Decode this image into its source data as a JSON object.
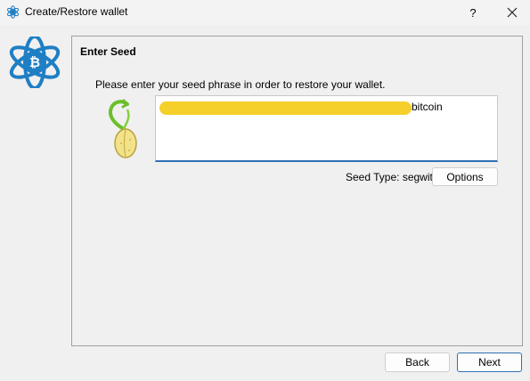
{
  "window": {
    "title": "Create/Restore wallet",
    "help_label": "?"
  },
  "panel": {
    "title": "Enter Seed",
    "instructions": "Please enter your seed phrase in order to restore your wallet.",
    "seed_visible_word": "bitcoin",
    "seed_type": "Seed Type: segwit",
    "options_label": "Options"
  },
  "footer": {
    "back_label": "Back",
    "next_label": "Next"
  },
  "colors": {
    "accent": "#2f6fb5",
    "redaction": "#f5cf2a",
    "logo_blue": "#1f7fc4"
  },
  "icons": {
    "title": "electrum-logo-icon",
    "help": "help-icon",
    "close": "close-icon",
    "logo": "electrum-logo-icon",
    "seed": "seed-sprout-icon"
  }
}
